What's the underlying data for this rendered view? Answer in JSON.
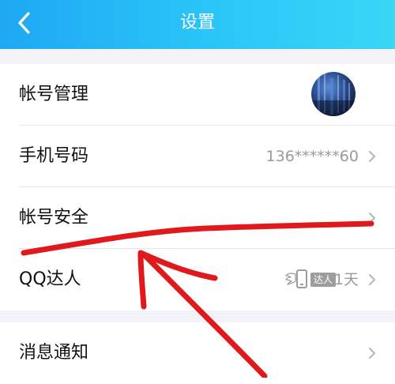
{
  "header": {
    "title": "设置",
    "back_icon": "chevron-left-icon",
    "gradient": [
      "#1ea8f3",
      "#39d6f7"
    ]
  },
  "settings": {
    "account_management": {
      "label": "帐号管理"
    },
    "phone_number": {
      "label": "手机号码",
      "value": "136******60"
    },
    "account_security": {
      "label": "帐号安全"
    },
    "qq_expert": {
      "label": "QQ达人",
      "badge_text": "达人",
      "days": "1天"
    },
    "notifications": {
      "label": "消息通知"
    }
  },
  "annotation": {
    "color": "#e0191c"
  }
}
